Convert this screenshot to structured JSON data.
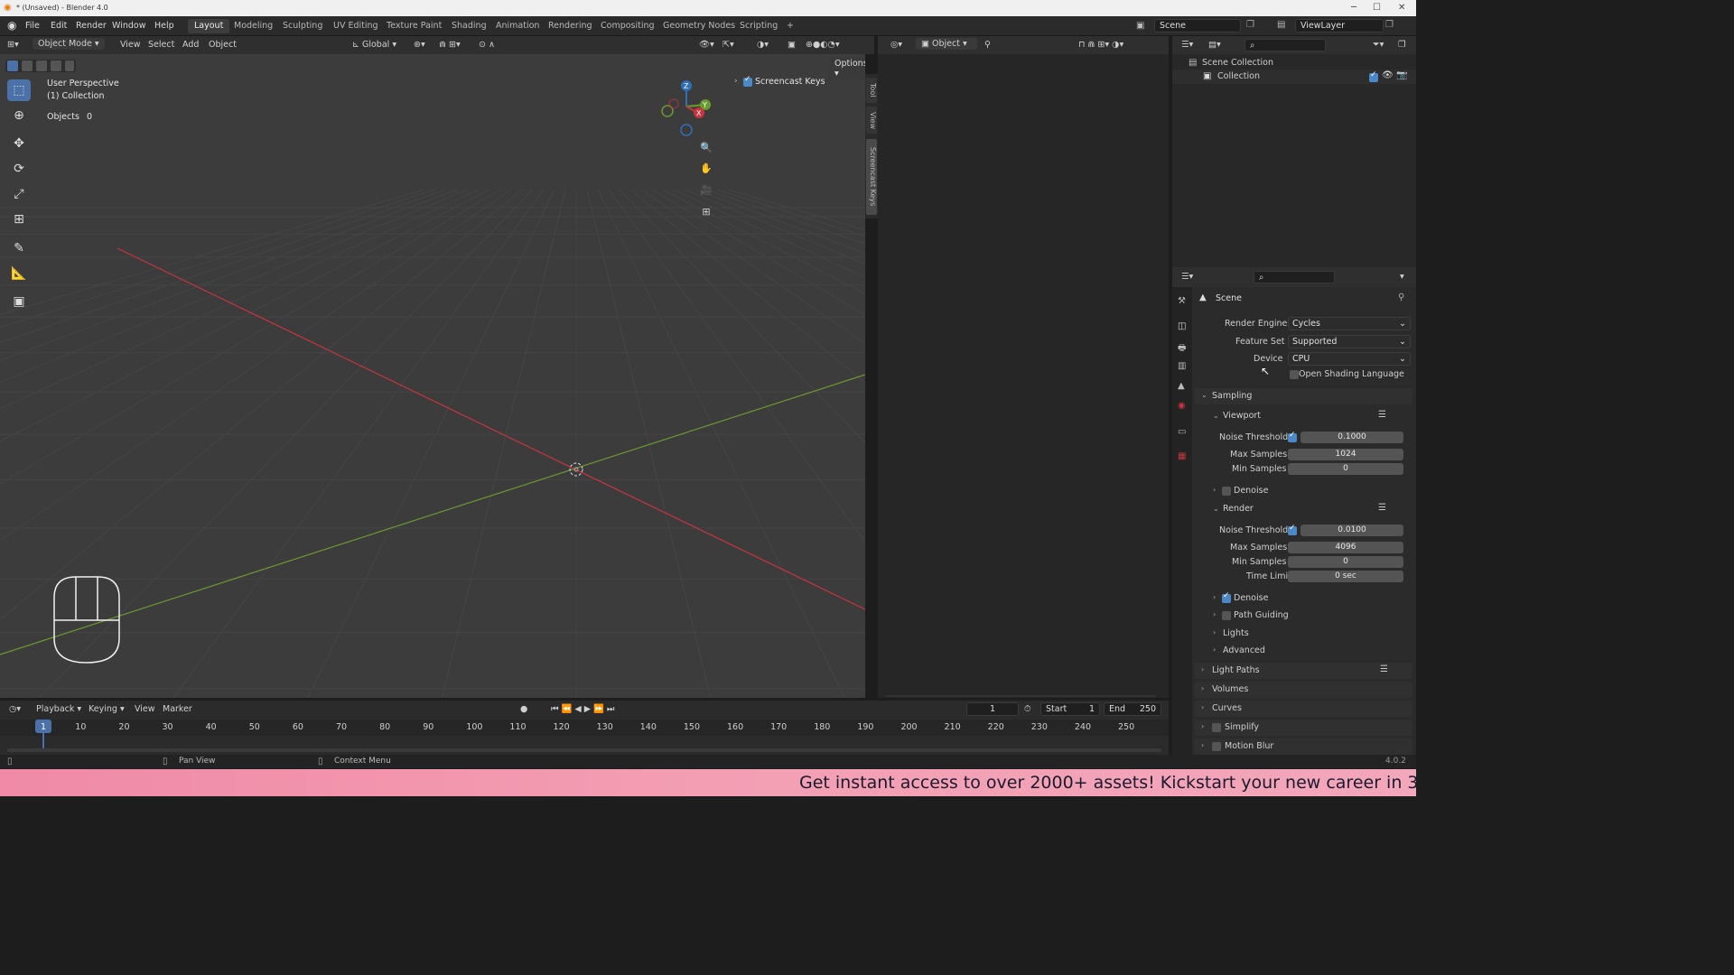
{
  "window": {
    "title": "* (Unsaved) - Blender 4.0"
  },
  "topbar": {
    "menus": [
      "File",
      "Edit",
      "Render",
      "Window",
      "Help"
    ],
    "workspaces": [
      "Layout",
      "Modeling",
      "Sculpting",
      "UV Editing",
      "Texture Paint",
      "Shading",
      "Animation",
      "Rendering",
      "Compositing",
      "Geometry Nodes",
      "Scripting"
    ],
    "active_workspace": "Layout",
    "add_workspace": "+",
    "scene": "Scene",
    "view_layer": "ViewLayer"
  },
  "viewport_header": {
    "mode": "Object Mode",
    "menus": [
      "View",
      "Select",
      "Add",
      "Object"
    ],
    "orientation": "Global",
    "options_label": "Options"
  },
  "viewport": {
    "perspective": "User Perspective",
    "collection": "(1) Collection",
    "objects_label": "Objects",
    "objects_count": "0",
    "screencast_label": "Screencast Keys",
    "screencast_checked": true,
    "gizmo": {
      "x": "X",
      "y": "Y",
      "z": "Z"
    },
    "side_tabs": [
      "Tool",
      "View",
      "Screencast Keys"
    ]
  },
  "empty_area": {
    "mode": "Object"
  },
  "outliner": {
    "scene_collection": "Scene Collection",
    "collection": "Collection"
  },
  "properties": {
    "context": "Scene",
    "render_engine_label": "Render Engine",
    "render_engine": "Cycles",
    "feature_set_label": "Feature Set",
    "feature_set": "Supported",
    "device_label": "Device",
    "device": "CPU",
    "osl_label": "Open Shading Language",
    "sampling": "Sampling",
    "viewport_label": "Viewport",
    "vp_noise_threshold_label": "Noise Threshold",
    "vp_noise_threshold": "0.1000",
    "vp_max_samples_label": "Max Samples",
    "vp_max_samples": "1024",
    "vp_min_samples_label": "Min Samples",
    "vp_min_samples": "0",
    "vp_denoise_label": "Denoise",
    "render_label": "Render",
    "r_noise_threshold_label": "Noise Threshold",
    "r_noise_threshold": "0.0100",
    "r_max_samples_label": "Max Samples",
    "r_max_samples": "4096",
    "r_min_samples_label": "Min Samples",
    "r_min_samples": "0",
    "r_time_limit_label": "Time Limit",
    "r_time_limit": "0 sec",
    "r_denoise_label": "Denoise",
    "path_guiding_label": "Path Guiding",
    "lights_label": "Lights",
    "advanced_label": "Advanced",
    "light_paths_label": "Light Paths",
    "volumes_label": "Volumes",
    "curves_label": "Curves",
    "simplify_label": "Simplify",
    "motion_blur_label": "Motion Blur"
  },
  "timeline": {
    "menus": [
      "Playback",
      "Keying",
      "View",
      "Marker"
    ],
    "current_frame": "1",
    "start_label": "Start",
    "start": "1",
    "end_label": "End",
    "end": "250",
    "ticks": [
      "1",
      "10",
      "20",
      "30",
      "40",
      "50",
      "60",
      "70",
      "80",
      "90",
      "100",
      "110",
      "120",
      "130",
      "140",
      "150",
      "160",
      "170",
      "180",
      "190",
      "200",
      "210",
      "220",
      "230",
      "240",
      "250"
    ]
  },
  "statusbar": {
    "pan_view": "Pan View",
    "context_menu": "Context Menu",
    "version": "4.0.2"
  },
  "banner": {
    "text": "Get instant access to over 2000+ assets! Kickstart your new career in 3"
  },
  "colors": {
    "accent": "#4a72a8",
    "x_axis": "#c9343f",
    "y_axis": "#6b9a2f",
    "z_axis": "#2f6fb8"
  }
}
